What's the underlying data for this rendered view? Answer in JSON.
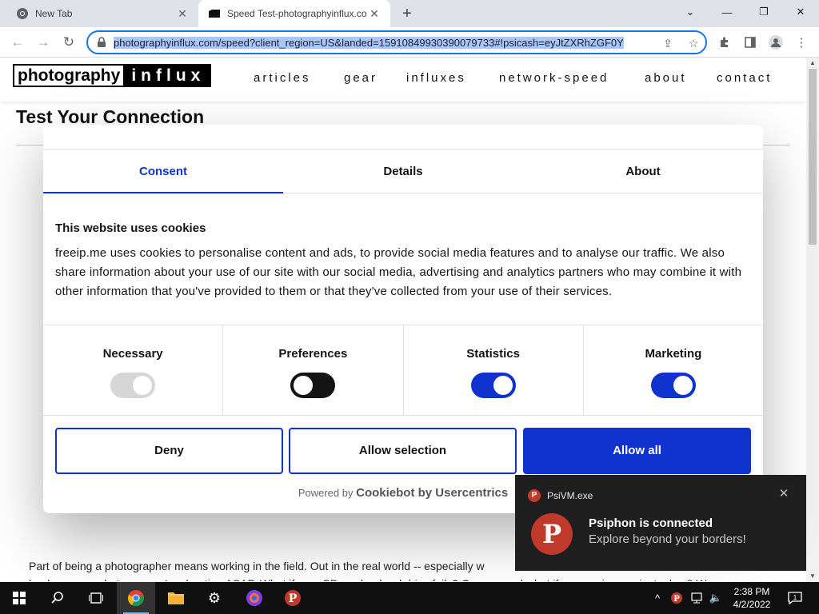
{
  "browser": {
    "tabs": [
      {
        "title": "New Tab"
      },
      {
        "title": "Speed Test-photographyinflux.co"
      }
    ],
    "url": "photographyinflux.com/speed?client_region=US&landed=15910849930390079733#!psicash=eyJtZXRhZGF0Y"
  },
  "site": {
    "logo_left": "photography",
    "logo_right": "influx",
    "nav": [
      "articles",
      "gear",
      "influxes",
      "network-speed",
      "about",
      "contact"
    ],
    "page_title": "Test Your Connection",
    "article_line1": "Part of being a photographer means working in the field. Out in the real world -- especially w",
    "article_line2": "landscape or whatever, you're shooting ASAP. What if your SD card or hard drive fails? Or you need what if you are in a project, also 8 W"
  },
  "consent": {
    "tabs": [
      "Consent",
      "Details",
      "About"
    ],
    "heading": "This website uses cookies",
    "body": "freeip.me uses cookies to personalise content and ads, to provide social media features and to analyse our traffic. We also share information about your use of our site with our social media, advertising and analytics partners who may combine it with other information that you've provided to them or that they've collected from your use of their services.",
    "preferences": [
      {
        "label": "Necessary",
        "state": "on-disabled"
      },
      {
        "label": "Preferences",
        "state": "off"
      },
      {
        "label": "Statistics",
        "state": "on"
      },
      {
        "label": "Marketing",
        "state": "on"
      }
    ],
    "buttons": {
      "deny": "Deny",
      "allow_selection": "Allow selection",
      "allow_all": "Allow all"
    },
    "powered_by": "Powered by",
    "powered_brand": "Cookiebot by Usercentrics",
    "accent_color": "#1032cf"
  },
  "toast": {
    "app_name": "PsiVM.exe",
    "title": "Psiphon is connected",
    "message": "Explore beyond your borders!"
  },
  "taskbar": {
    "time": "2:38 PM",
    "date": "4/2/2022",
    "notification_count": "1"
  }
}
